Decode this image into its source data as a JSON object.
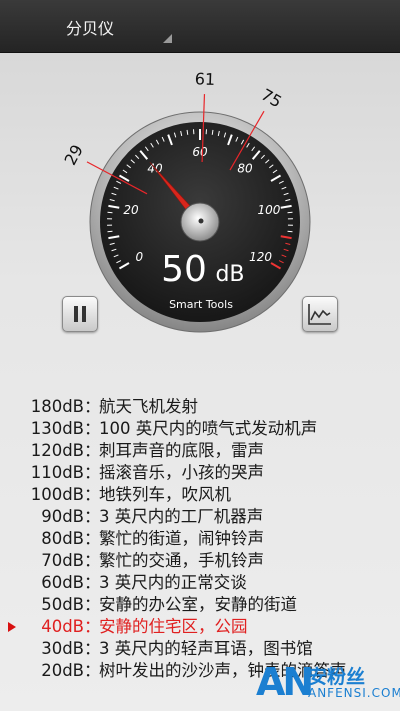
{
  "app": {
    "title": "分贝仪"
  },
  "gauge": {
    "min_db": 0,
    "max_db": 120,
    "current_db": 40,
    "reading_value": "50",
    "reading_unit": "dB",
    "brand": "Smart Tools",
    "scale_labels": [
      "0",
      "20",
      "40",
      "60",
      "80",
      "100",
      "120"
    ],
    "markers": [
      {
        "label": "29",
        "value": 29
      },
      {
        "label": "61",
        "value": 61
      },
      {
        "label": "75",
        "value": 75
      }
    ],
    "colors": {
      "needle": "#d8261c",
      "marker_line": "#e8262a",
      "dial": "#1e1e1e"
    }
  },
  "controls": {
    "pause_icon": "pause-icon",
    "chart_icon": "line-chart-icon"
  },
  "levels": [
    {
      "level": "180dB",
      "sep": "：",
      "desc": "航天飞机发射",
      "active": false
    },
    {
      "level": "130dB",
      "sep": "：",
      "desc": "100 英尺内的喷气式发动机声",
      "active": false
    },
    {
      "level": "120dB",
      "sep": "：",
      "desc": "刺耳声音的底限，雷声",
      "active": false
    },
    {
      "level": "110dB",
      "sep": "：",
      "desc": "摇滚音乐，小孩的哭声",
      "active": false
    },
    {
      "level": "100dB",
      "sep": "：",
      "desc": "地铁列车，吹风机",
      "active": false
    },
    {
      "level": "90dB",
      "sep": "：",
      "desc": "3 英尺内的工厂机器声",
      "active": false
    },
    {
      "level": "80dB",
      "sep": "：",
      "desc": "繁忙的街道，闹钟铃声",
      "active": false
    },
    {
      "level": "70dB",
      "sep": "：",
      "desc": "繁忙的交通，手机铃声",
      "active": false
    },
    {
      "level": "60dB",
      "sep": "：",
      "desc": "3 英尺内的正常交谈",
      "active": false
    },
    {
      "level": "50dB",
      "sep": "：",
      "desc": "安静的办公室，安静的街道",
      "active": false
    },
    {
      "level": "40dB",
      "sep": "：",
      "desc": "安静的住宅区，公园",
      "active": true
    },
    {
      "level": "30dB",
      "sep": "：",
      "desc": "3 英尺内的轻声耳语，图书馆",
      "active": false
    },
    {
      "level": "20dB",
      "sep": "：",
      "desc": "树叶发出的沙沙声，钟表的滴答声",
      "active": false
    }
  ],
  "watermark": {
    "logo": "AN",
    "cn": "安粉丝",
    "en": "ANFENSI.COM"
  }
}
